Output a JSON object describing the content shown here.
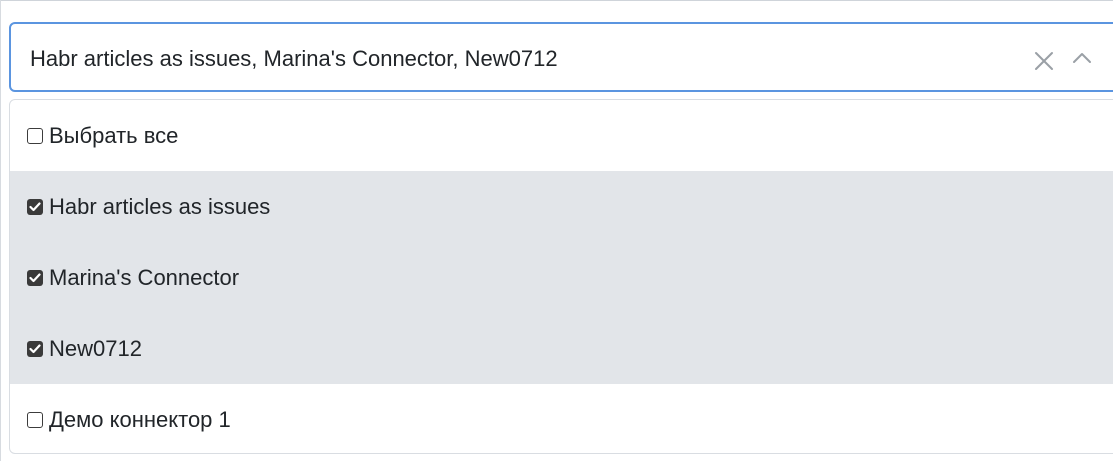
{
  "select": {
    "value_text": "Habr articles as issues, Marina's Connector, New0712",
    "clear_icon": "close-icon",
    "toggle_icon": "chevron-up-icon",
    "accent_color": "#5b95e0"
  },
  "dropdown": {
    "options": [
      {
        "label": "Выбрать все",
        "checked": false
      },
      {
        "label": "Habr articles as issues",
        "checked": true
      },
      {
        "label": "Marina's Connector",
        "checked": true
      },
      {
        "label": "New0712",
        "checked": true
      },
      {
        "label": "Демо коннектор 1",
        "checked": false
      }
    ],
    "selected_bg": "#e2e5e9"
  }
}
